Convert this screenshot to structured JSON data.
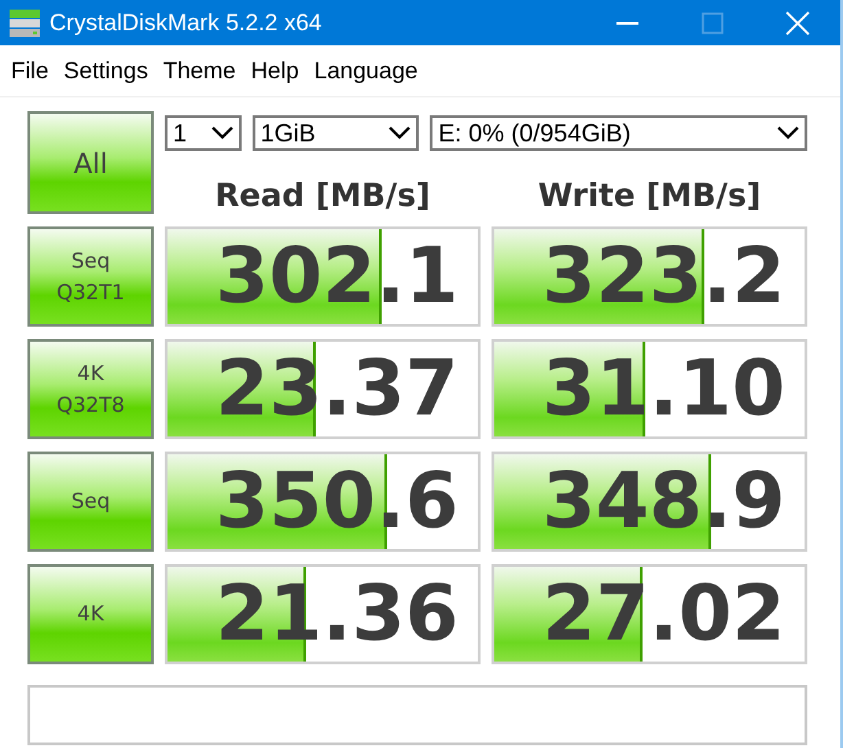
{
  "window": {
    "title": "CrystalDiskMark 5.2.2 x64"
  },
  "menu": [
    "File",
    "Settings",
    "Theme",
    "Help",
    "Language"
  ],
  "all_button": "All",
  "selectors": {
    "count": "1",
    "size": "1GiB",
    "drive": "E: 0% (0/954GiB)"
  },
  "headers": [
    "Read [MB/s]",
    "Write [MB/s]"
  ],
  "tests": [
    {
      "label": [
        "Seq",
        "Q32T1"
      ],
      "read": {
        "value": "302.1",
        "level": 0.68
      },
      "write": {
        "value": "323.2",
        "level": 0.67
      }
    },
    {
      "label": [
        "4K",
        "Q32T8"
      ],
      "read": {
        "value": "23.37",
        "level": 0.47
      },
      "write": {
        "value": "31.10",
        "level": 0.48
      }
    },
    {
      "label": [
        "Seq"
      ],
      "read": {
        "value": "350.6",
        "level": 0.7
      },
      "write": {
        "value": "348.9",
        "level": 0.69
      }
    },
    {
      "label": [
        "4K"
      ],
      "read": {
        "value": "21.36",
        "level": 0.44
      },
      "write": {
        "value": "27.02",
        "level": 0.47
      }
    }
  ]
}
